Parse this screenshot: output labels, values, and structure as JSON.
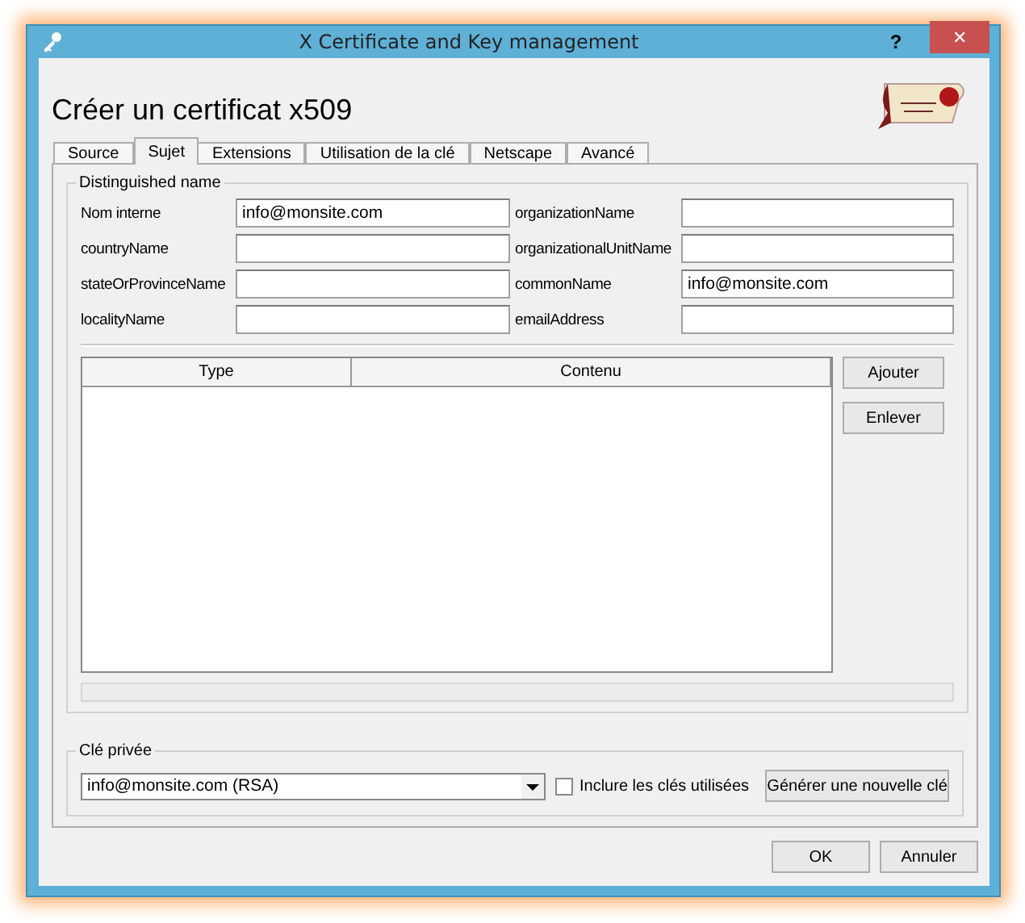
{
  "window": {
    "title": "X Certificate and Key management",
    "help": "?",
    "close": "✕"
  },
  "heading": "Créer un certificat x509",
  "tabs": [
    {
      "label": "Source",
      "selected": false
    },
    {
      "label": "Sujet",
      "selected": true
    },
    {
      "label": "Extensions",
      "selected": false
    },
    {
      "label": "Utilisation de la clé",
      "selected": false
    },
    {
      "label": "Netscape",
      "selected": false
    },
    {
      "label": "Avancé",
      "selected": false
    }
  ],
  "distinguished_name": {
    "title": "Distinguished name",
    "fields": [
      {
        "label": "Nom interne",
        "value": "info@monsite.com"
      },
      {
        "label": "organizationName"
      },
      {
        "label": "countryName"
      },
      {
        "label": "organizationalUnitName"
      },
      {
        "label": "stateOrProvinceName"
      },
      {
        "label": "commonName",
        "value": "info@monsite.com"
      },
      {
        "label": "localityName"
      },
      {
        "label": "emailAddress"
      }
    ],
    "table": {
      "columns": [
        "Type",
        "Contenu"
      ]
    },
    "buttons": [
      "Ajouter",
      "Enlever"
    ]
  },
  "private_key": {
    "title": "Clé privée",
    "key": "info@monsite.com (RSA)",
    "include_used": {
      "label": "Inclure les clés utilisées",
      "checked": false
    },
    "generate_button": "Générer une nouvelle clé"
  },
  "buttons": [
    "OK",
    "Annuler"
  ]
}
